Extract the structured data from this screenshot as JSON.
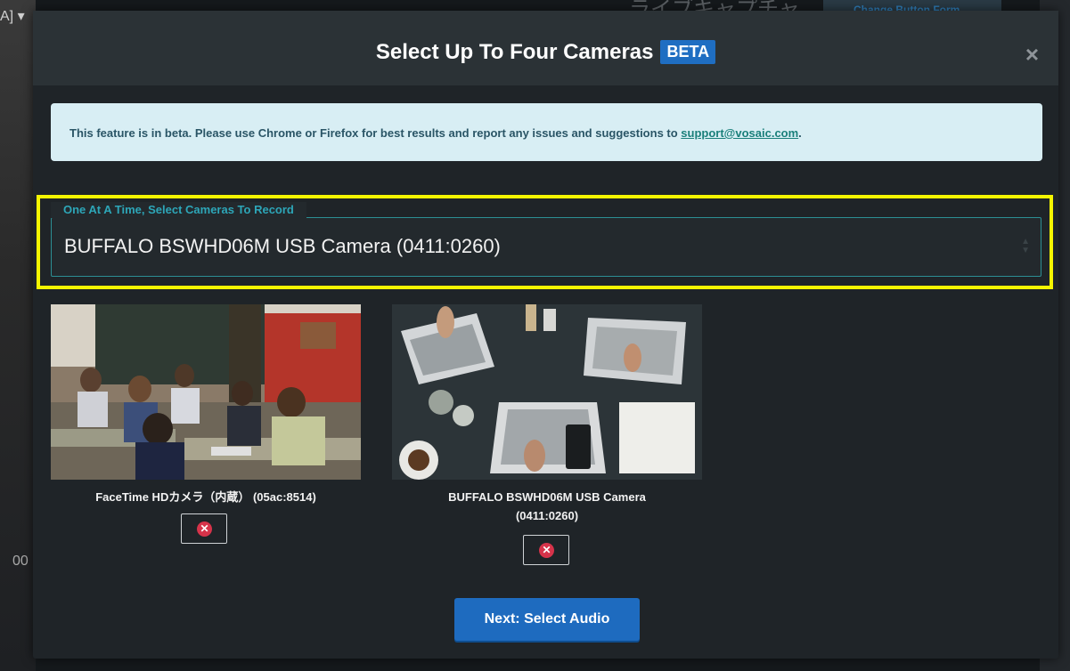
{
  "background": {
    "top_left_text": "A] ▾",
    "top_center_text": "ライブキャプチャ",
    "top_right_button": "Change Button Form",
    "left_number": "00"
  },
  "modal": {
    "title": "Select Up To Four Cameras",
    "badge": "BETA",
    "close_icon": "×",
    "alert": {
      "text": "This feature is in beta. Please use Chrome or Firefox for best results and report any issues and suggestions to ",
      "link": "support@vosaic.com",
      "suffix": "."
    },
    "camera_select": {
      "legend": "One At A Time, Select Cameras To Record",
      "selected_value": "BUFFALO BSWHD06M USB Camera (0411:0260)"
    },
    "cameras": [
      {
        "label": "FaceTime HDカメラ（内蔵） (05ac:8514)",
        "remove_icon": "x-circle-icon"
      },
      {
        "label_line1": "BUFFALO BSWHD06M USB Camera",
        "label_line2": "(0411:0260)",
        "remove_icon": "x-circle-icon"
      }
    ],
    "next_button": "Next: Select Audio"
  },
  "colors": {
    "accent": "#1e6bbf",
    "highlight": "#f5f600",
    "teal": "#2c8f94",
    "danger": "#d6334a"
  }
}
